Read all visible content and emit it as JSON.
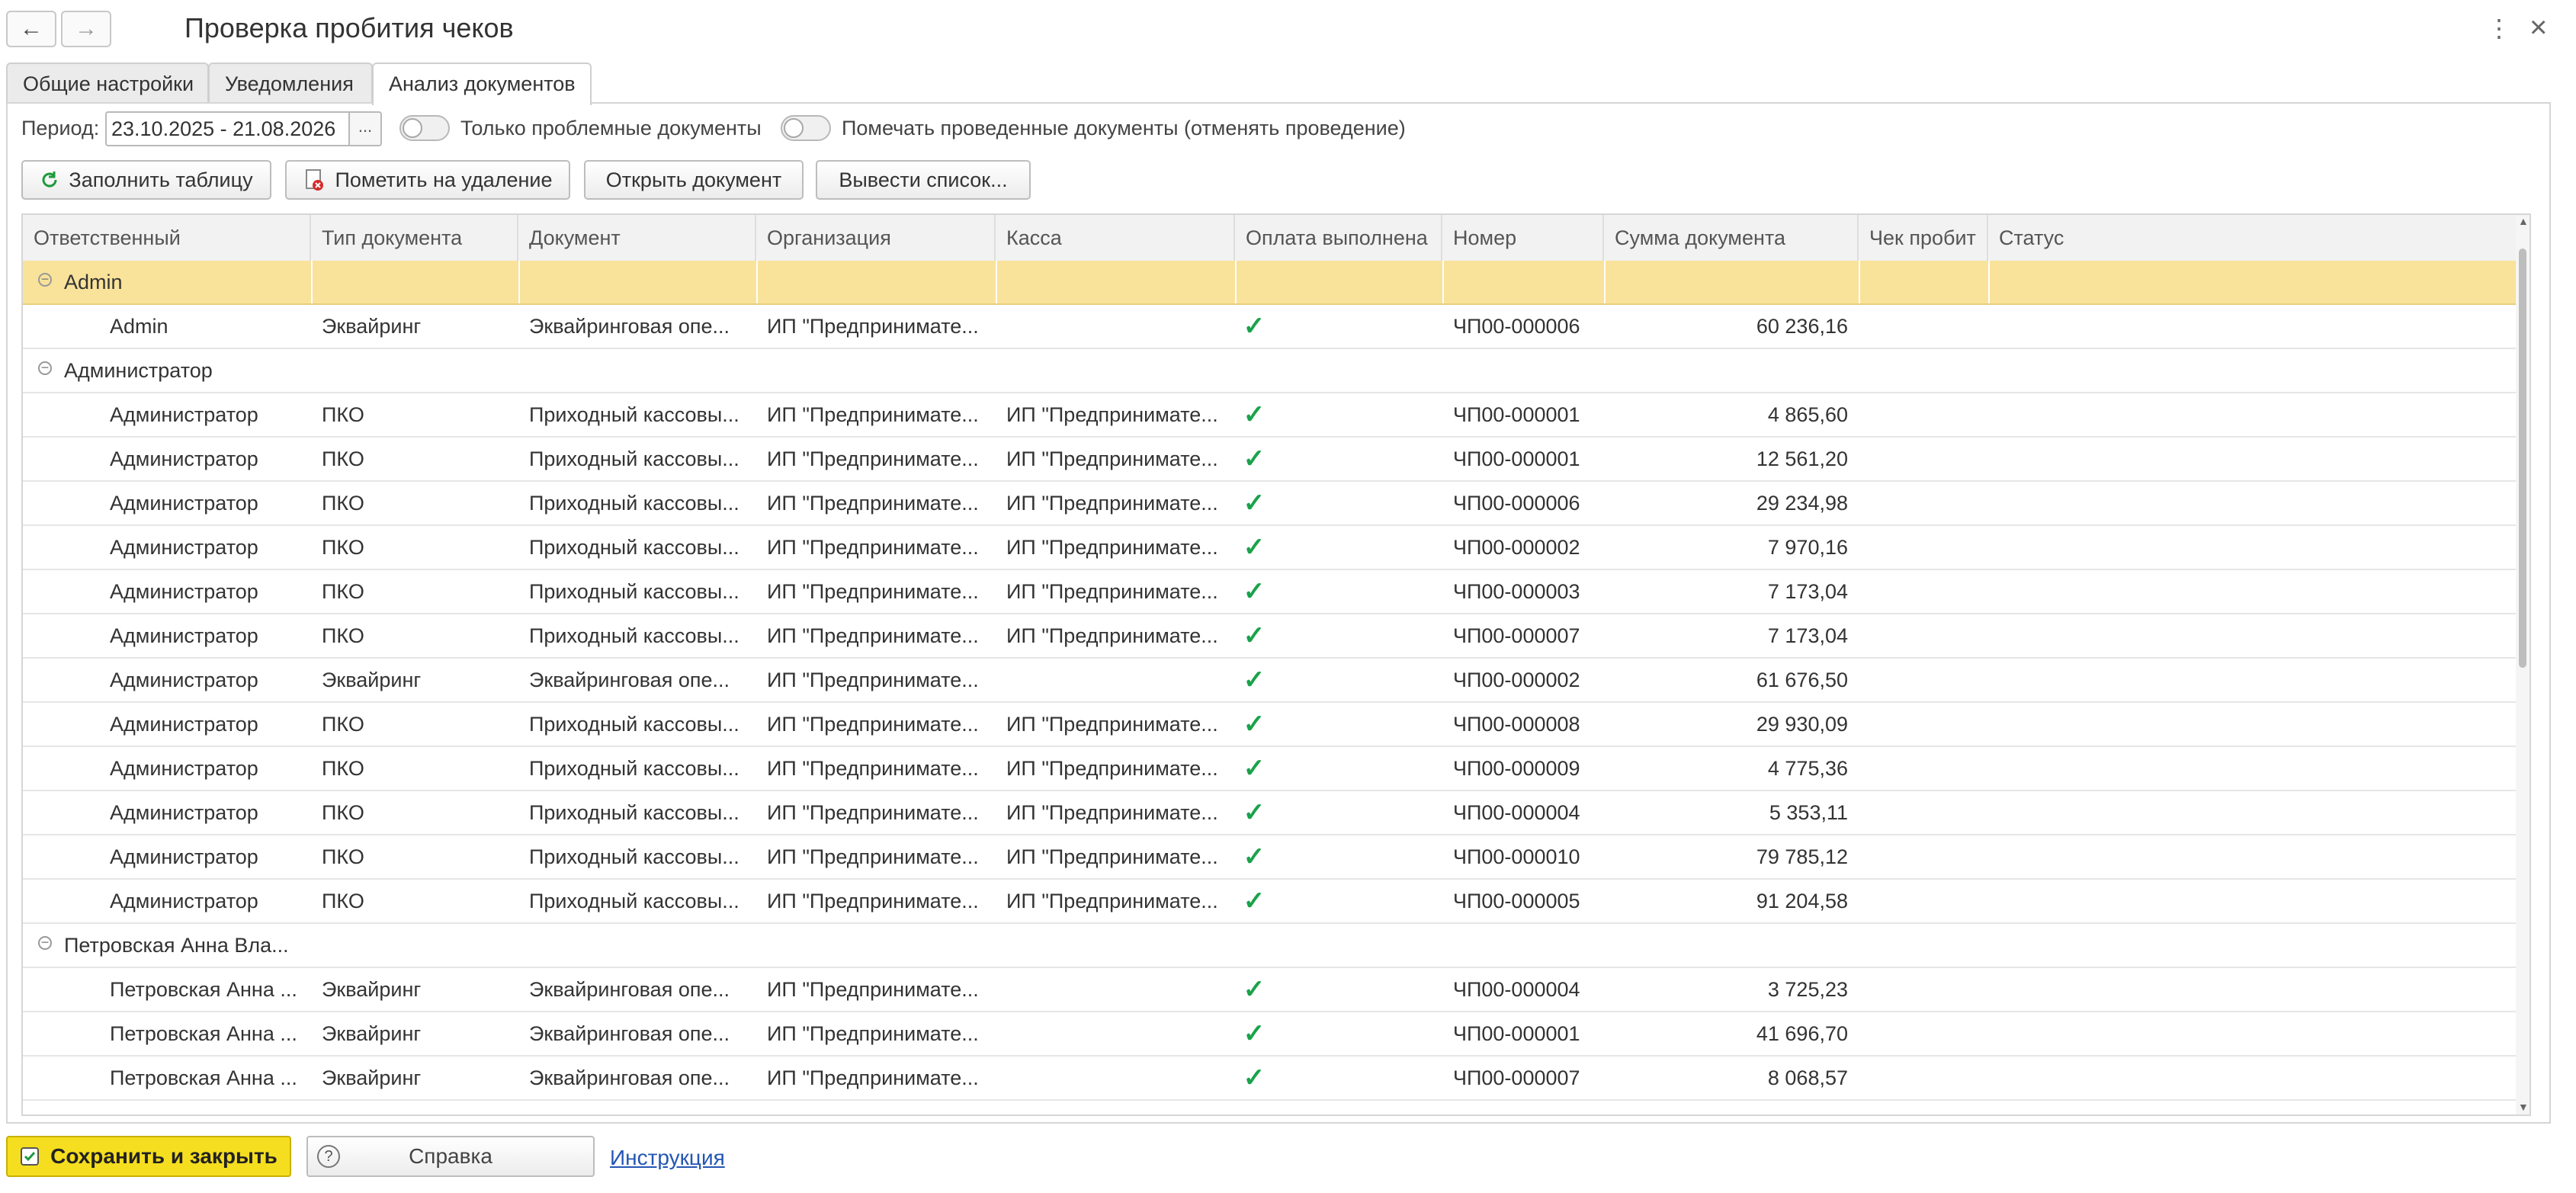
{
  "window": {
    "title": "Проверка пробития чеков",
    "back_icon": "←",
    "forward_icon": "→",
    "more_icon": "⋮",
    "close_icon": "×"
  },
  "tabs": [
    {
      "label": "Общие настройки",
      "active": false
    },
    {
      "label": "Уведомления",
      "active": false
    },
    {
      "label": "Анализ документов",
      "active": true
    }
  ],
  "filters": {
    "period_label": "Период:",
    "period_value": "23.10.2025 - 21.08.2026",
    "period_button": "...",
    "only_problem_label": "Только проблемные документы",
    "only_problem_on": false,
    "mark_posted_label": "Помечать проведенные документы (отменять проведение)",
    "mark_posted_on": false
  },
  "toolbar": {
    "fill_table": "Заполнить таблицу",
    "mark_delete": "Пометить на удаление",
    "open_doc": "Открыть документ",
    "list_out": "Вывести список..."
  },
  "table": {
    "columns": [
      "Ответственный",
      "Тип документа",
      "Документ",
      "Организация",
      "Касса",
      "Оплата выполнена",
      "Номер",
      "Сумма документа",
      "Чек пробит",
      "Статус"
    ],
    "check_glyph": "✓",
    "rows": [
      {
        "group": true,
        "selected": true,
        "name": "Admin"
      },
      {
        "resp": "Admin",
        "type": "Эквайринг",
        "doc": "Эквайринговая опе...",
        "org": "ИП \"Предпринимате...",
        "kassa": "",
        "paid": true,
        "num": "ЧП00-000006",
        "sum": "60 236,16",
        "check": "",
        "status": ""
      },
      {
        "group": true,
        "selected": false,
        "name": "Администратор"
      },
      {
        "resp": "Администратор",
        "type": "ПКО",
        "doc": "Приходный кассовы...",
        "org": "ИП \"Предпринимате...",
        "kassa": "ИП \"Предпринимате...",
        "paid": true,
        "num": "ЧП00-000001",
        "sum": "4 865,60",
        "check": "",
        "status": ""
      },
      {
        "resp": "Администратор",
        "type": "ПКО",
        "doc": "Приходный кассовы...",
        "org": "ИП \"Предпринимате...",
        "kassa": "ИП \"Предпринимате...",
        "paid": true,
        "num": "ЧП00-000001",
        "sum": "12 561,20",
        "check": "",
        "status": ""
      },
      {
        "resp": "Администратор",
        "type": "ПКО",
        "doc": "Приходный кассовы...",
        "org": "ИП \"Предпринимате...",
        "kassa": "ИП \"Предпринимате...",
        "paid": true,
        "num": "ЧП00-000006",
        "sum": "29 234,98",
        "check": "",
        "status": ""
      },
      {
        "resp": "Администратор",
        "type": "ПКО",
        "doc": "Приходный кассовы...",
        "org": "ИП \"Предпринимате...",
        "kassa": "ИП \"Предпринимате...",
        "paid": true,
        "num": "ЧП00-000002",
        "sum": "7 970,16",
        "check": "",
        "status": ""
      },
      {
        "resp": "Администратор",
        "type": "ПКО",
        "doc": "Приходный кассовы...",
        "org": "ИП \"Предпринимате...",
        "kassa": "ИП \"Предпринимате...",
        "paid": true,
        "num": "ЧП00-000003",
        "sum": "7 173,04",
        "check": "",
        "status": ""
      },
      {
        "resp": "Администратор",
        "type": "ПКО",
        "doc": "Приходный кассовы...",
        "org": "ИП \"Предпринимате...",
        "kassa": "ИП \"Предпринимате...",
        "paid": true,
        "num": "ЧП00-000007",
        "sum": "7 173,04",
        "check": "",
        "status": ""
      },
      {
        "resp": "Администратор",
        "type": "Эквайринг",
        "doc": "Эквайринговая опе...",
        "org": "ИП \"Предпринимате...",
        "kassa": "",
        "paid": true,
        "num": "ЧП00-000002",
        "sum": "61 676,50",
        "check": "",
        "status": ""
      },
      {
        "resp": "Администратор",
        "type": "ПКО",
        "doc": "Приходный кассовы...",
        "org": "ИП \"Предпринимате...",
        "kassa": "ИП \"Предпринимате...",
        "paid": true,
        "num": "ЧП00-000008",
        "sum": "29 930,09",
        "check": "",
        "status": ""
      },
      {
        "resp": "Администратор",
        "type": "ПКО",
        "doc": "Приходный кассовы...",
        "org": "ИП \"Предпринимате...",
        "kassa": "ИП \"Предпринимате...",
        "paid": true,
        "num": "ЧП00-000009",
        "sum": "4 775,36",
        "check": "",
        "status": ""
      },
      {
        "resp": "Администратор",
        "type": "ПКО",
        "doc": "Приходный кассовы...",
        "org": "ИП \"Предпринимате...",
        "kassa": "ИП \"Предпринимате...",
        "paid": true,
        "num": "ЧП00-000004",
        "sum": "5 353,11",
        "check": "",
        "status": ""
      },
      {
        "resp": "Администратор",
        "type": "ПКО",
        "doc": "Приходный кассовы...",
        "org": "ИП \"Предпринимате...",
        "kassa": "ИП \"Предпринимате...",
        "paid": true,
        "num": "ЧП00-000010",
        "sum": "79 785,12",
        "check": "",
        "status": ""
      },
      {
        "resp": "Администратор",
        "type": "ПКО",
        "doc": "Приходный кассовы...",
        "org": "ИП \"Предпринимате...",
        "kassa": "ИП \"Предпринимате...",
        "paid": true,
        "num": "ЧП00-000005",
        "sum": "91 204,58",
        "check": "",
        "status": ""
      },
      {
        "group": true,
        "selected": false,
        "name": "Петровская Анна Вла..."
      },
      {
        "resp": "Петровская Анна ...",
        "type": "Эквайринг",
        "doc": "Эквайринговая опе...",
        "org": "ИП \"Предпринимате...",
        "kassa": "",
        "paid": true,
        "num": "ЧП00-000004",
        "sum": "3 725,23",
        "check": "",
        "status": ""
      },
      {
        "resp": "Петровская Анна ...",
        "type": "Эквайринг",
        "doc": "Эквайринговая опе...",
        "org": "ИП \"Предпринимате...",
        "kassa": "",
        "paid": true,
        "num": "ЧП00-000001",
        "sum": "41 696,70",
        "check": "",
        "status": ""
      },
      {
        "resp": "Петровская Анна ...",
        "type": "Эквайринг",
        "doc": "Эквайринговая опе...",
        "org": "ИП \"Предпринимате...",
        "kassa": "",
        "paid": true,
        "num": "ЧП00-000007",
        "sum": "8 068,57",
        "check": "",
        "status": ""
      }
    ]
  },
  "footer": {
    "save_close": "Сохранить и закрыть",
    "help": "Справка",
    "help_icon": "?",
    "instruction_link": "Инструкция"
  },
  "colors": {
    "accent_yellow": "#f5de1f",
    "selected_row": "#f9e29a",
    "check_green": "#1aa24a",
    "link_blue": "#2456b3"
  }
}
